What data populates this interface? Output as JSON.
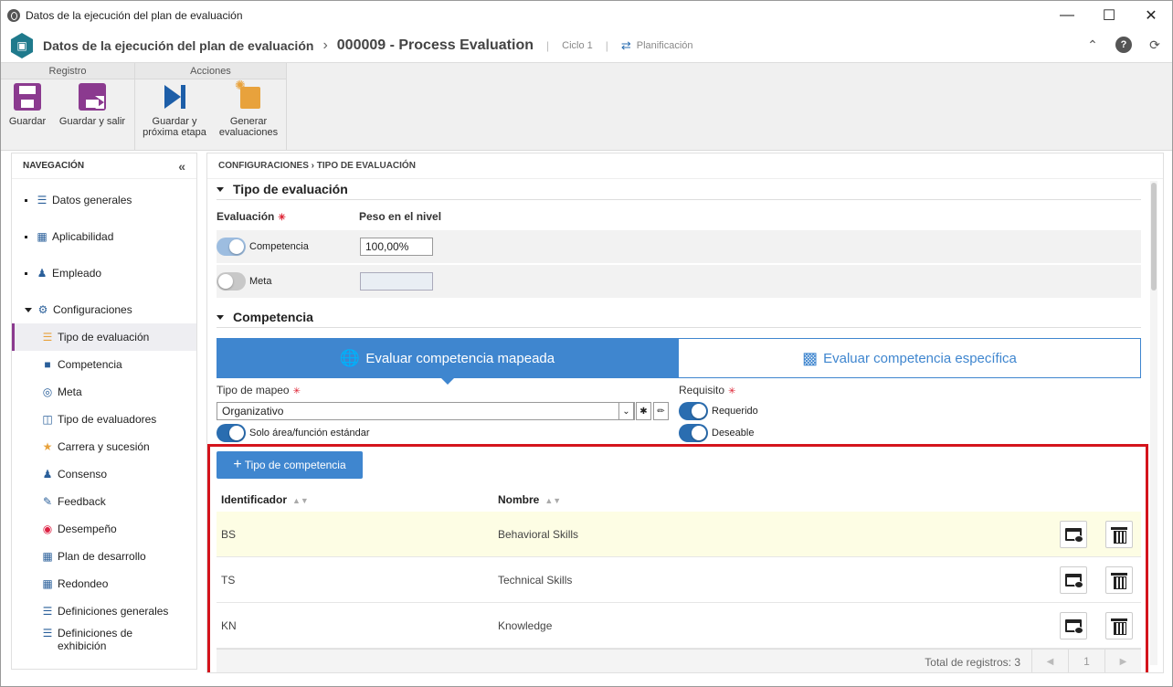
{
  "window": {
    "title": "Datos de la ejecución del plan de evaluación"
  },
  "header": {
    "title": "Datos de la ejecución del plan de evaluación",
    "separator": "›",
    "record": "000009 - Process Evaluation",
    "cycle": "Ciclo 1",
    "status": "Planificación"
  },
  "toolbar": {
    "groups": [
      {
        "label": "Registro"
      },
      {
        "label": "Acciones"
      }
    ],
    "save": "Guardar",
    "save_exit": "Guardar y salir",
    "save_next_1": "Guardar y",
    "save_next_2": "próxima etapa",
    "generate_1": "Generar",
    "generate_2": "evaluaciones"
  },
  "nav": {
    "heading": "NAVEGACIÓN",
    "items": [
      {
        "label": "Datos generales",
        "icon": "list-icon"
      },
      {
        "label": "Aplicabilidad",
        "icon": "applicability-icon"
      },
      {
        "label": "Empleado",
        "icon": "employee-icon"
      },
      {
        "label": "Configuraciones",
        "icon": "gear-icon"
      },
      {
        "label": "Tipo de evaluación",
        "icon": "evaluation-type-icon"
      },
      {
        "label": "Competencia",
        "icon": "puzzle-icon"
      },
      {
        "label": "Meta",
        "icon": "target-icon"
      },
      {
        "label": "Tipo de evaluadores",
        "icon": "evaluators-icon"
      },
      {
        "label": "Carrera y sucesión",
        "icon": "star-person-icon"
      },
      {
        "label": "Consenso",
        "icon": "consensus-icon"
      },
      {
        "label": "Feedback",
        "icon": "feedback-icon"
      },
      {
        "label": "Desempeño",
        "icon": "performance-icon"
      },
      {
        "label": "Plan de desarrollo",
        "icon": "plan-icon"
      },
      {
        "label": "Redondeo",
        "icon": "calculator-icon"
      },
      {
        "label": "Definiciones generales",
        "icon": "settings-doc-icon"
      },
      {
        "label": "Definiciones de",
        "label2": "exhibición",
        "icon": "display-settings-icon"
      }
    ]
  },
  "main": {
    "breadcrumb": "CONFIGURACIONES  ›  TIPO DE EVALUACIÓN",
    "section1": "Tipo de evaluación",
    "col_evaluation": "Evaluación",
    "col_weight": "Peso en el nivel",
    "competencia_label": "Competencia",
    "competencia_weight": "100,00%",
    "meta_label": "Meta",
    "meta_weight": "",
    "section2": "Competencia",
    "tab_mapped": "Evaluar competencia mapeada",
    "tab_specific": "Evaluar competencia específica",
    "mapping_label": "Tipo de mapeo",
    "mapping_value": "Organizativo",
    "standard_only": "Solo área/función estándar",
    "requirement_label": "Requisito",
    "required": "Requerido",
    "desirable": "Deseable",
    "add_button": "Tipo de competencia",
    "grid": {
      "headers": [
        "Identificador",
        "Nombre"
      ],
      "rows": [
        {
          "id": "BS",
          "name": "Behavioral Skills"
        },
        {
          "id": "TS",
          "name": "Technical Skills"
        },
        {
          "id": "KN",
          "name": "Knowledge"
        }
      ],
      "total": "Total de registros: 3",
      "page": "1"
    }
  },
  "colors": {
    "accent": "#3f86cf",
    "brand": "#8b3a8f",
    "highlight": "#d4141c"
  }
}
